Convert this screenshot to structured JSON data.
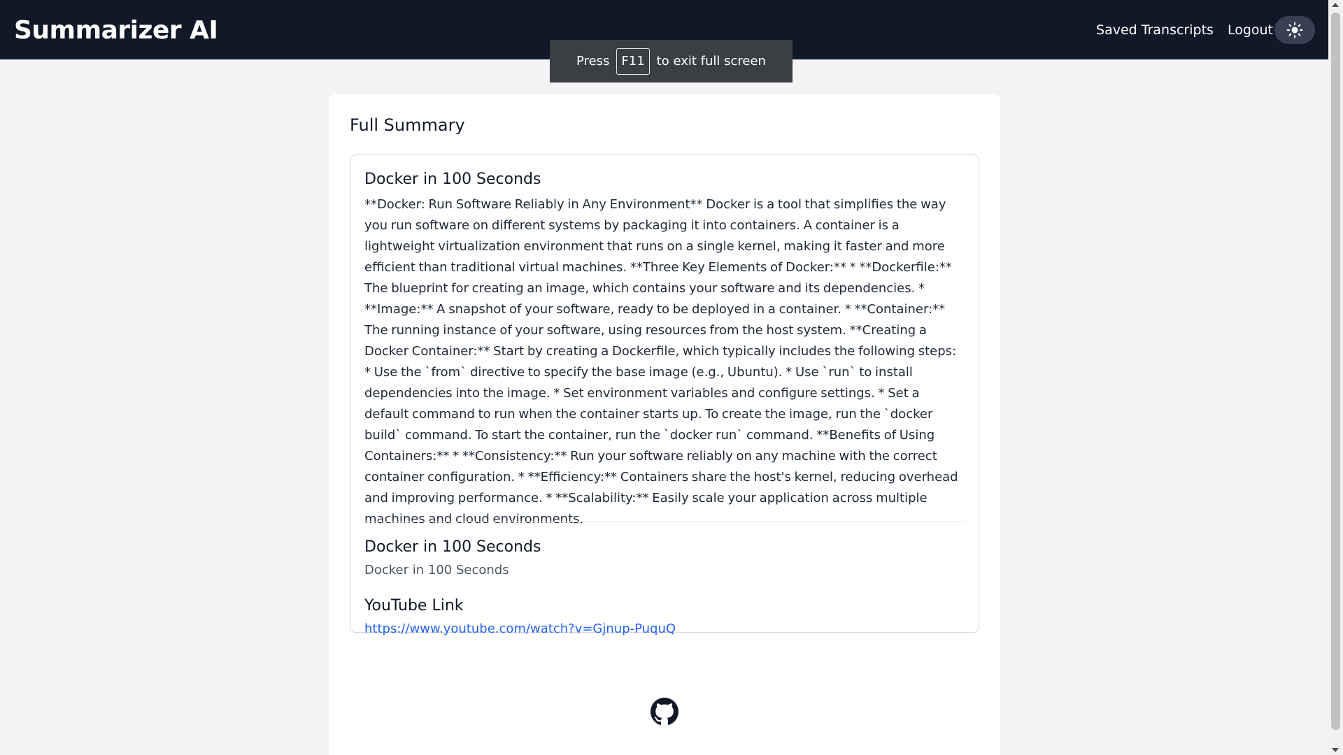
{
  "header": {
    "brand": "Summarizer AI",
    "nav": {
      "saved_label": "Saved Transcripts",
      "logout_label": "Logout"
    },
    "theme_icon": "sun-icon"
  },
  "fullscreen_toast": {
    "prefix": "Press",
    "key": "F11",
    "suffix": "to exit full screen"
  },
  "card": {
    "title": "Full Summary",
    "summary": {
      "heading": "Docker in 100 Seconds",
      "text": "**Docker: Run Software Reliably in Any Environment** Docker is a tool that simplifies the way you run software on different systems by packaging it into containers. A container is a lightweight virtualization environment that runs on a single kernel, making it faster and more efficient than traditional virtual machines. **Three Key Elements of Docker:** * **Dockerfile:** The blueprint for creating an image, which contains your software and its dependencies. * **Image:** A snapshot of your software, ready to be deployed in a container. * **Container:** The running instance of your software, using resources from the host system. **Creating a Docker Container:** Start by creating a Dockerfile, which typically includes the following steps: * Use the `from` directive to specify the base image (e.g., Ubuntu). * Use `run` to install dependencies into the image. * Set environment variables and configure settings. * Set a default command to run when the container starts up. To create the image, run the `docker build` command. To start the container, run the `docker run` command. **Benefits of Using Containers:** * **Consistency:** Run your software reliably on any machine with the correct container configuration. * **Efficiency:** Containers share the host's kernel, reducing overhead and improving performance. * **Scalability:** Easily scale your application across multiple machines and cloud environments."
    },
    "title_section": {
      "heading": "Docker in 100 Seconds",
      "value": "Docker in 100 Seconds"
    },
    "link_section": {
      "heading": "YouTube Link",
      "url": "https://www.youtube.com/watch?v=Gjnup-PuquQ"
    }
  },
  "footer": {
    "icon": "github-icon"
  },
  "colors": {
    "navbar": "#111827",
    "background": "#f3f4f6",
    "link": "#2563eb"
  }
}
